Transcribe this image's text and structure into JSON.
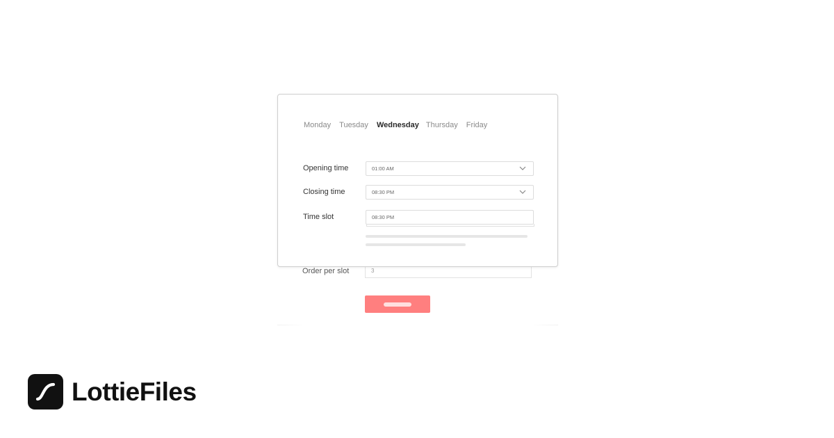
{
  "tabs": {
    "items": [
      "Monday",
      "Tuesday",
      "Wednesday",
      "Thursday",
      "Friday"
    ],
    "active": "Wednesday"
  },
  "form": {
    "opening_time": {
      "label": "Opening time",
      "value": "01:00 AM"
    },
    "closing_time": {
      "label": "Closing time",
      "value": "08:30 PM"
    },
    "time_slot": {
      "label": "Time slot",
      "value": "08:30 PM"
    },
    "order_per_slot": {
      "label": "Order per slot",
      "value": "3"
    }
  },
  "brand": {
    "name": "LottieFiles",
    "logo_icon": "lottie-s-curve-icon",
    "accent_color": "#ff7f7f",
    "logo_color": "#111111"
  }
}
